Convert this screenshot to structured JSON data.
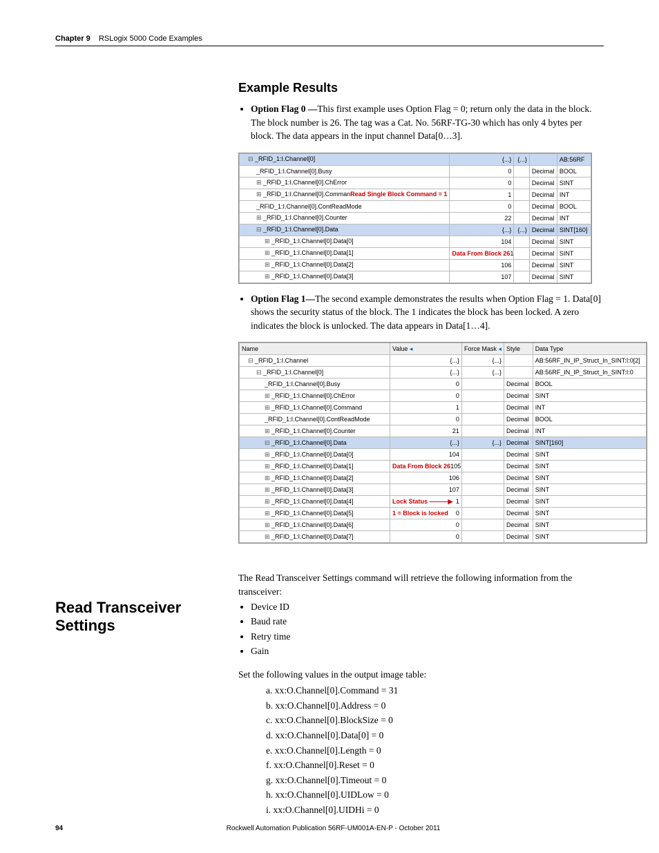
{
  "header": {
    "chapter": "Chapter 9",
    "title": "RSLogix 5000 Code Examples"
  },
  "sec1": {
    "heading": "Example Results",
    "bullet1_label": "Option Flag 0 —",
    "bullet1_text": "This first example uses Option Flag = 0; return only the data in the block. The block number is 26. The tag was a Cat. No. 56RF-TG-30 which has only 4 bytes per block. The data appears in the input channel Data[0…3].",
    "bullet2_label": "Option Flag 1—",
    "bullet2_text": "The second example demonstrates the results when Option Flag = 1. Data[0] shows the security status of the block. The 1 indicates the block has been locked. A zero indicates the block is unlocked. The data appears in Data[1…4]."
  },
  "fig1": {
    "anno_cmd": "Read Single Block Command = 1",
    "anno_data": "Data From Block 26",
    "rows": [
      {
        "name": "_RFID_1:I.Channel[0]",
        "value": "{...}",
        "force": "{...}",
        "style": "",
        "type": "AB:56RF",
        "hl": true,
        "pad": "pad1",
        "tree": "tree-c"
      },
      {
        "name": "_RFID_1:I.Channel[0].Busy",
        "value": "0",
        "force": "",
        "style": "Decimal",
        "type": "BOOL",
        "hl": false,
        "pad": "pad2",
        "tree": ""
      },
      {
        "name": "_RFID_1:I.Channel[0].ChError",
        "value": "0",
        "force": "",
        "style": "Decimal",
        "type": "SINT",
        "hl": false,
        "pad": "pad2",
        "tree": "tree-e"
      },
      {
        "name": "_RFID_1:I.Channel[0].Comman",
        "value": "1",
        "force": "",
        "style": "Decimal",
        "type": "INT",
        "hl": false,
        "pad": "pad2",
        "tree": "tree-e",
        "anno": "cmd"
      },
      {
        "name": "_RFID_1:I.Channel[0].ContReadMode",
        "value": "0",
        "force": "",
        "style": "Decimal",
        "type": "BOOL",
        "hl": false,
        "pad": "pad2",
        "tree": ""
      },
      {
        "name": "_RFID_1:I.Channel[0].Counter",
        "value": "22",
        "force": "",
        "style": "Decimal",
        "type": "INT",
        "hl": false,
        "pad": "pad2",
        "tree": "tree-e"
      },
      {
        "name": "_RFID_1:I.Channel[0].Data",
        "value": "{...}",
        "force": "{...}",
        "style": "Decimal",
        "type": "SINT[160]",
        "hl": true,
        "pad": "pad2",
        "tree": "tree-c"
      },
      {
        "name": "_RFID_1:I.Channel[0].Data[0]",
        "value": "104",
        "force": "",
        "style": "Decimal",
        "type": "SINT",
        "hl": false,
        "pad": "pad3",
        "tree": "tree-e"
      },
      {
        "name": "_RFID_1:I.Channel[0].Data[1]",
        "value": "105",
        "force": "",
        "style": "Decimal",
        "type": "SINT",
        "hl": false,
        "pad": "pad3",
        "tree": "tree-e",
        "anno": "data"
      },
      {
        "name": "_RFID_1:I.Channel[0].Data[2]",
        "value": "106",
        "force": "",
        "style": "Decimal",
        "type": "SINT",
        "hl": false,
        "pad": "pad3",
        "tree": "tree-e"
      },
      {
        "name": "_RFID_1:I.Channel[0].Data[3]",
        "value": "107",
        "force": "",
        "style": "Decimal",
        "type": "SINT",
        "hl": false,
        "pad": "pad3",
        "tree": "tree-e"
      }
    ]
  },
  "fig2": {
    "header": {
      "c1": "Name",
      "c2": "Value",
      "c3": "Force Mask",
      "c4": "Style",
      "c5": "Data Type"
    },
    "anno_data": "Data From Block 26",
    "anno_lock": "Lock Status",
    "anno_lock2": "1 = Block is locked",
    "rows": [
      {
        "name": "_RFID_1:I.Channel",
        "value": "{...}",
        "force": "{...}",
        "style": "",
        "type": "AB:56RF_IN_IP_Struct_In_SINT:I:0[2]",
        "hl": false,
        "pad": "pad1",
        "tree": "tree-c"
      },
      {
        "name": "_RFID_1:I.Channel[0]",
        "value": "{...}",
        "force": "{...}",
        "style": "",
        "type": "AB:56RF_IN_IP_Struct_In_SINT:I:0",
        "hl": false,
        "pad": "pad2",
        "tree": "tree-c"
      },
      {
        "name": "_RFID_1:I.Channel[0].Busy",
        "value": "0",
        "force": "",
        "style": "Decimal",
        "type": "BOOL",
        "hl": false,
        "pad": "pad3",
        "tree": ""
      },
      {
        "name": "_RFID_1:I.Channel[0].ChError",
        "value": "0",
        "force": "",
        "style": "Decimal",
        "type": "SINT",
        "hl": false,
        "pad": "pad3",
        "tree": "tree-e"
      },
      {
        "name": "_RFID_1:I.Channel[0].Command",
        "value": "1",
        "force": "",
        "style": "Decimal",
        "type": "INT",
        "hl": false,
        "pad": "pad3",
        "tree": "tree-e"
      },
      {
        "name": "_RFID_1:I.Channel[0].ContReadMode",
        "value": "0",
        "force": "",
        "style": "Decimal",
        "type": "BOOL",
        "hl": false,
        "pad": "pad3",
        "tree": ""
      },
      {
        "name": "_RFID_1:I.Channel[0].Counter",
        "value": "21",
        "force": "",
        "style": "Decimal",
        "type": "INT",
        "hl": false,
        "pad": "pad3",
        "tree": "tree-e"
      },
      {
        "name": "_RFID_1:I.Channel[0].Data",
        "value": "{...}",
        "force": "{...}",
        "style": "Decimal",
        "type": "SINT[160]",
        "hl": true,
        "pad": "pad3",
        "tree": "tree-c"
      },
      {
        "name": "_RFID_1:I.Channel[0].Data[0]",
        "value": "104",
        "force": "",
        "style": "Decimal",
        "type": "SINT",
        "hl": false,
        "pad": "pad3",
        "tree": "tree-e"
      },
      {
        "name": "_RFID_1:I.Channel[0].Data[1]",
        "value": "105",
        "force": "",
        "style": "Decimal",
        "type": "SINT",
        "hl": false,
        "pad": "pad3",
        "tree": "tree-e",
        "anno": "data"
      },
      {
        "name": "_RFID_1:I.Channel[0].Data[2]",
        "value": "106",
        "force": "",
        "style": "Decimal",
        "type": "SINT",
        "hl": false,
        "pad": "pad3",
        "tree": "tree-e"
      },
      {
        "name": "_RFID_1:I.Channel[0].Data[3]",
        "value": "107",
        "force": "",
        "style": "Decimal",
        "type": "SINT",
        "hl": false,
        "pad": "pad3",
        "tree": "tree-e"
      },
      {
        "name": "_RFID_1:I.Channel[0].Data[4]",
        "value": "1",
        "force": "",
        "style": "Decimal",
        "type": "SINT",
        "hl": false,
        "pad": "pad3",
        "tree": "tree-e",
        "anno": "lock"
      },
      {
        "name": "_RFID_1:I.Channel[0].Data[5]",
        "value": "0",
        "force": "",
        "style": "Decimal",
        "type": "SINT",
        "hl": false,
        "pad": "pad3",
        "tree": "tree-e",
        "anno": "lock2"
      },
      {
        "name": "_RFID_1:I.Channel[0].Data[6]",
        "value": "0",
        "force": "",
        "style": "Decimal",
        "type": "SINT",
        "hl": false,
        "pad": "pad3",
        "tree": "tree-e"
      },
      {
        "name": "_RFID_1:I.Channel[0].Data[7]",
        "value": "0",
        "force": "",
        "style": "Decimal",
        "type": "SINT",
        "hl": false,
        "pad": "pad3",
        "tree": "tree-e"
      }
    ]
  },
  "sec2": {
    "heading": "Read Transceiver Settings",
    "intro": "The Read Transceiver Settings command will retrieve the following information from the transceiver:",
    "bullets": [
      "Device ID",
      "Baud rate",
      "Retry time",
      "Gain"
    ],
    "lead2": "Set the following values in the output image table:",
    "steps": [
      "a.  xx:O.Channel[0].Command = 31",
      "b.  xx:O.Channel[0].Address = 0",
      "c.  xx:O.Channel[0].BlockSize = 0",
      "d.  xx:O.Channel[0].Data[0] = 0",
      "e.  xx:O.Channel[0].Length = 0",
      "f.  xx:O.Channel[0].Reset = 0",
      "g.  xx:O.Channel[0].Timeout = 0",
      "h.  xx:O.Channel[0].UIDLow = 0",
      "i.  xx:O.Channel[0].UIDHi = 0"
    ]
  },
  "footer": {
    "page": "94",
    "pub": "Rockwell Automation Publication 56RF-UM001A-EN-P - October 2011"
  }
}
